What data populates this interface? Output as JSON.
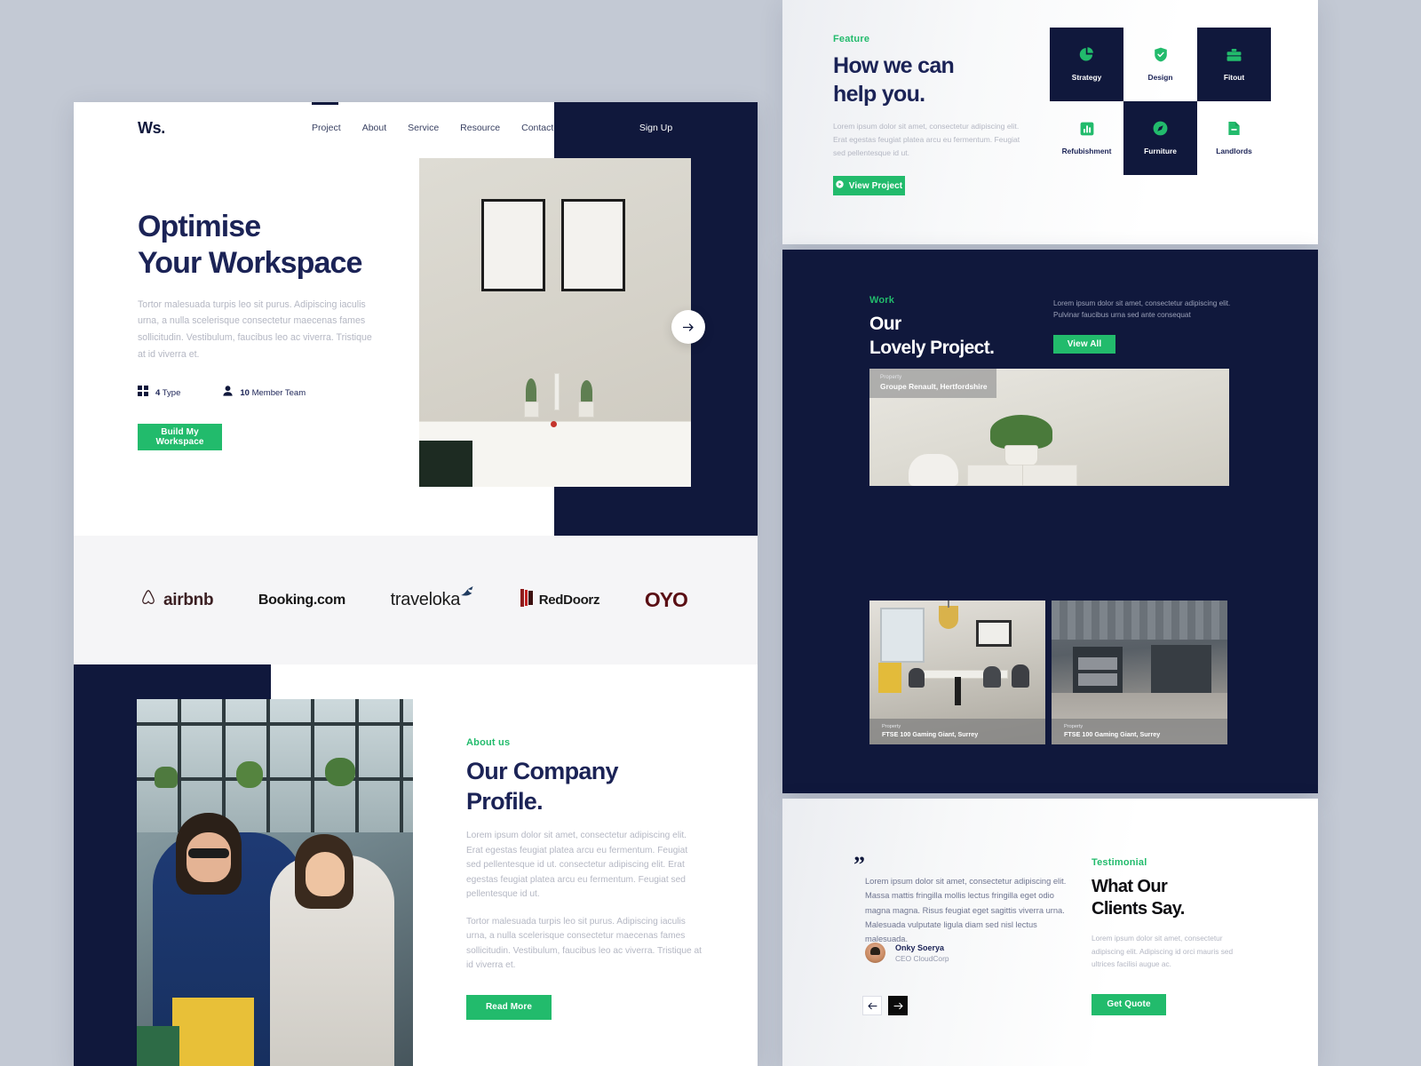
{
  "site": {
    "brand": "Ws.",
    "accent_green": "#22bb6c",
    "navy": "#10183c",
    "page_bg": "#c3c9d4"
  },
  "nav": {
    "items": [
      "Project",
      "About",
      "Service",
      "Resource",
      "Contact"
    ],
    "signup_label": "Sign Up"
  },
  "hero": {
    "title_line1": "Optimise",
    "title_line2": "Your Workspace",
    "paragraph": "Tortor malesuada turpis leo sit purus. Adipiscing iaculis urna, a nulla scelerisque consectetur maecenas fames sollicitudin. Vestibulum, faucibus leo ac viverra. Tristique at id viverra et.",
    "meta": [
      {
        "icon": "grid-icon",
        "value": "4",
        "label": "Type"
      },
      {
        "icon": "user-icon",
        "value": "10",
        "label": "Member Team"
      }
    ],
    "cta_label": "Build My Workspace",
    "carousel_arrow": "arrow-right-icon"
  },
  "logos": [
    {
      "name": "airbnb",
      "text": "airbnb"
    },
    {
      "name": "booking",
      "text": "Booking.com"
    },
    {
      "name": "traveloka",
      "text": "traveloka"
    },
    {
      "name": "reddoorz",
      "text": "RedDoorz"
    },
    {
      "name": "oyo",
      "text": "OYO"
    }
  ],
  "about": {
    "eyebrow": "About us",
    "title_line1": "Our Company",
    "title_line2": "Profile.",
    "paragraph1": "Lorem ipsum dolor sit amet, consectetur adipiscing elit. Erat egestas feugiat platea arcu eu fermentum. Feugiat sed pellentesque id ut. consectetur adipiscing elit. Erat egestas feugiat platea arcu eu fermentum. Feugiat sed pellentesque id ut.",
    "paragraph2": "Tortor malesuada turpis leo sit purus. Adipiscing iaculis urna, a nulla scelerisque consectetur maecenas fames sollicitudin. Vestibulum, faucibus leo ac viverra. Tristique at id viverra et.",
    "cta_label": "Read More"
  },
  "feature": {
    "eyebrow": "Feature",
    "title_line1": "How we can",
    "title_line2": "help you.",
    "paragraph": "Lorem ipsum dolor sit amet, consectetur adipiscing elit. Erat egestas feugiat platea arcu eu fermentum. Feugiat sed pellentesque id ut.",
    "cta_label": "View Project",
    "cta_icon": "play-circle-icon",
    "items": [
      {
        "label": "Strategy",
        "icon": "pie-chart-icon",
        "active": true
      },
      {
        "label": "Design",
        "icon": "shield-check-icon",
        "active": false
      },
      {
        "label": "Fitout",
        "icon": "briefcase-icon",
        "active": true
      },
      {
        "label": "Refubishment",
        "icon": "bar-chart-icon",
        "active": false
      },
      {
        "label": "Furniture",
        "icon": "compass-icon",
        "active": true
      },
      {
        "label": "Landlords",
        "icon": "file-minus-icon",
        "active": false
      }
    ]
  },
  "work": {
    "eyebrow": "Work",
    "title_line1": "Our",
    "title_line2": "Lovely Project.",
    "paragraph": "Lorem ipsum dolor sit amet, consectetur adipiscing elit. Pulvinar faucibus urna sed ante consequat",
    "cta_label": "View All",
    "featured": {
      "kicker": "Property",
      "name": "Groupe Renault, Hertfordshire"
    },
    "cards": [
      {
        "kicker": "Property",
        "name": "FTSE 100 Gaming Giant, Surrey"
      },
      {
        "kicker": "Property",
        "name": "FTSE 100 Gaming Giant, Surrey"
      }
    ]
  },
  "testimonial": {
    "quote_mark": "”",
    "quote": "Lorem ipsum dolor sit amet, consectetur adipiscing elit. Massa mattis fringilla mollis lectus fringilla eget odio magna magna. Risus feugiat eget sagittis viverra urna. Malesuada vulputate ligula diam sed nisl lectus malesuada.",
    "author_name": "Onky Soerya",
    "author_role": "CEO CloudCorp",
    "prev_icon": "arrow-left-icon",
    "next_icon": "arrow-right-icon",
    "eyebrow": "Testimonial",
    "title_line1": "What Our",
    "title_line2": "Clients Say.",
    "paragraph": "Lorem ipsum dolor sit amet, consectetur adipiscing elit. Adipiscing id orci mauris sed ultrices facilisi augue ac.",
    "cta_label": "Get Quote"
  }
}
